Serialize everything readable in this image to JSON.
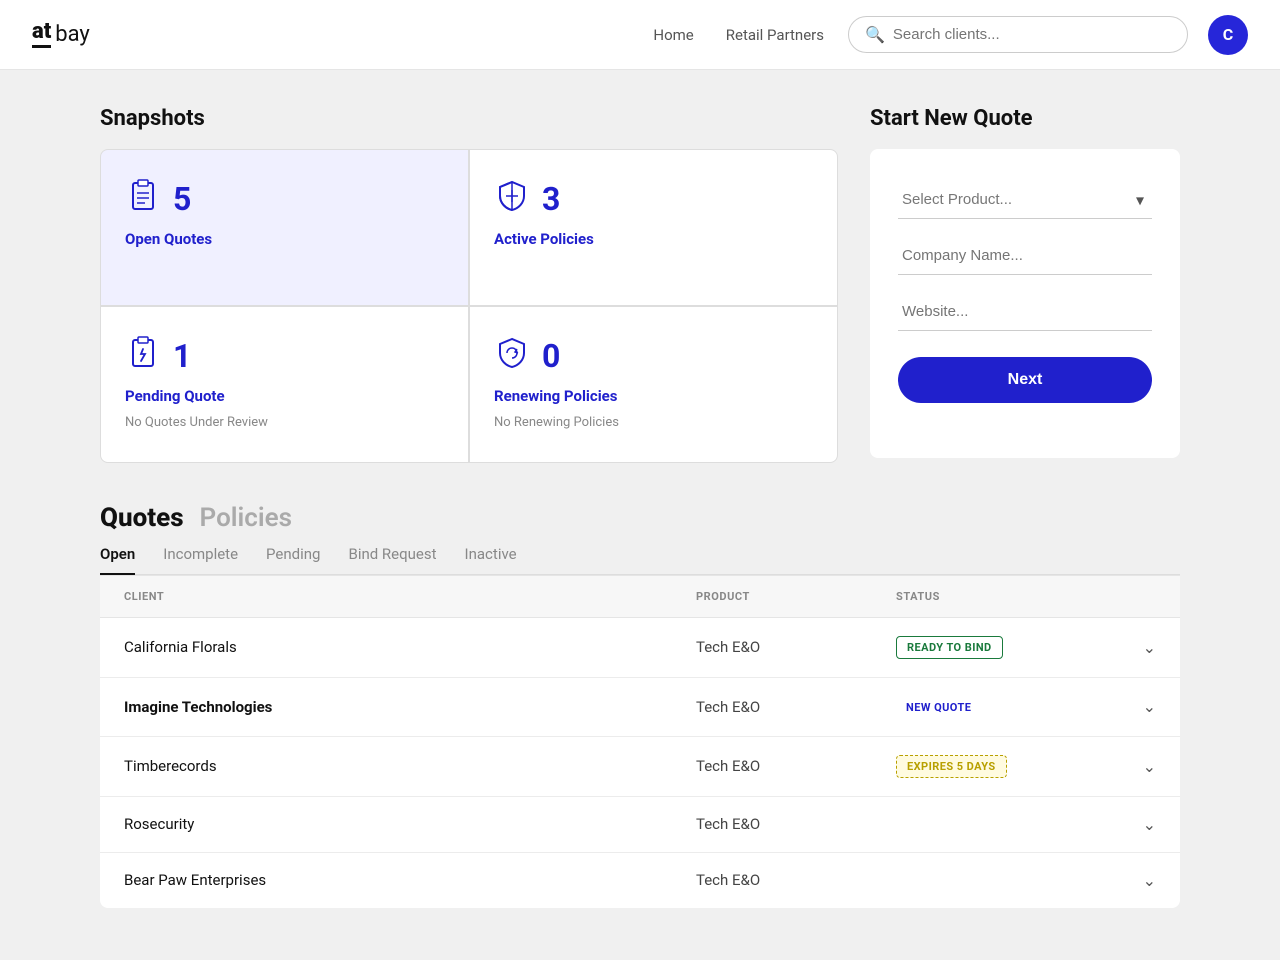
{
  "nav": {
    "logo_at": "at",
    "logo_bay": "bay",
    "links": [
      "Home",
      "Retail Partners"
    ],
    "search_placeholder": "Search clients...",
    "avatar_letter": "C"
  },
  "snapshots": {
    "title": "Snapshots",
    "cards": [
      {
        "id": "open-quotes",
        "count": "5",
        "label": "Open Quotes",
        "sub": "",
        "highlighted": true
      },
      {
        "id": "active-policies",
        "count": "3",
        "label": "Active Policies",
        "sub": "",
        "highlighted": false
      },
      {
        "id": "pending-quote",
        "count": "1",
        "label": "Pending Quote",
        "sub": "No Quotes Under Review",
        "highlighted": false
      },
      {
        "id": "renewing-policies",
        "count": "0",
        "label": "Renewing Policies",
        "sub": "No Renewing Policies",
        "highlighted": false
      }
    ]
  },
  "new_quote": {
    "title": "Start New Quote",
    "select_placeholder": "Select Product...",
    "company_placeholder": "Company Name...",
    "website_placeholder": "Website...",
    "next_label": "Next"
  },
  "quotes": {
    "active_tab": "Quotes",
    "inactive_tab": "Policies",
    "sub_tabs": [
      "Open",
      "Incomplete",
      "Pending",
      "Bind Request",
      "Inactive"
    ],
    "active_sub_tab": "Open",
    "columns": {
      "client": "CLIENT",
      "product": "PRODUCT",
      "status": "STATUS"
    },
    "rows": [
      {
        "client": "California Florals",
        "bold": false,
        "product": "Tech E&O",
        "status": "READY TO BIND",
        "status_type": "ready"
      },
      {
        "client": "Imagine Technologies",
        "bold": true,
        "product": "Tech E&O",
        "status": "NEW QUOTE",
        "status_type": "new"
      },
      {
        "client": "Timberecords",
        "bold": false,
        "product": "Tech E&O",
        "status": "EXPIRES 5 DAYS",
        "status_type": "expires"
      },
      {
        "client": "Rosecurity",
        "bold": false,
        "product": "Tech E&O",
        "status": "",
        "status_type": ""
      },
      {
        "client": "Bear Paw Enterprises",
        "bold": false,
        "product": "Tech E&O",
        "status": "",
        "status_type": ""
      }
    ]
  }
}
